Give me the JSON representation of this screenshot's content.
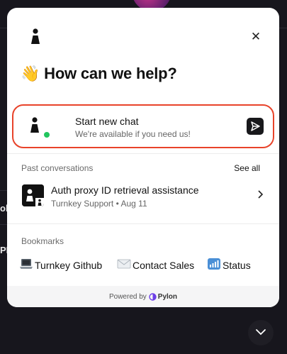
{
  "header": {
    "heading_emoji": "👋",
    "heading_text": "How can we help?",
    "close_glyph": "✕"
  },
  "new_chat": {
    "title": "Start new chat",
    "subtitle": "We're available if you need us!",
    "status_color": "#22c55e",
    "highlight_color": "#e8432a"
  },
  "conversations": {
    "section_label": "Past conversations",
    "see_all_label": "See all",
    "items": [
      {
        "title": "Auth proxy ID retrieval assistance",
        "meta": "Turnkey Support • Aug 11"
      }
    ]
  },
  "bookmarks": {
    "section_label": "Bookmarks",
    "items": [
      {
        "icon": "laptop-icon",
        "label": "Turnkey Github"
      },
      {
        "icon": "envelope-icon",
        "label": "Contact Sales"
      },
      {
        "icon": "bar-chart-icon",
        "label": "Status"
      }
    ]
  },
  "footer": {
    "powered_by": "Powered by",
    "brand": "Pylon"
  },
  "background": {
    "fragments": [
      "oli",
      "PI"
    ]
  },
  "launcher": {
    "icon": "chevron-down-icon"
  }
}
